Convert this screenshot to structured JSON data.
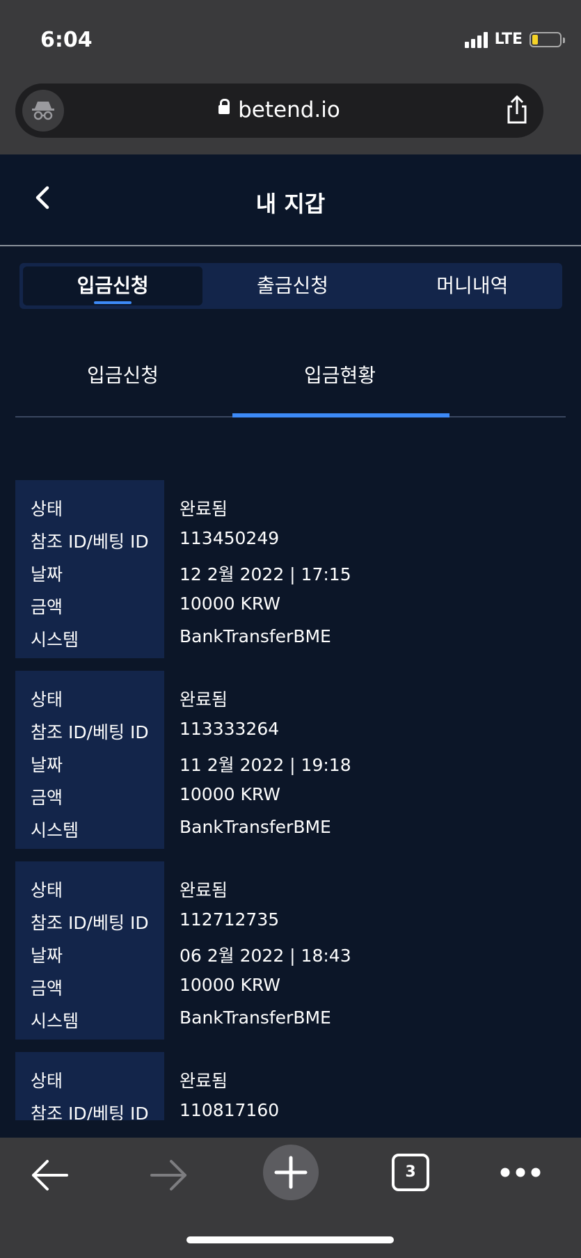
{
  "status_bar": {
    "time": "6:04",
    "network": "LTE",
    "battery_level": 0.2
  },
  "browser": {
    "url": "betend.io"
  },
  "header": {
    "title": "내 지갑"
  },
  "main_tabs": [
    {
      "label": "입금신청",
      "active": true
    },
    {
      "label": "출금신청",
      "active": false
    },
    {
      "label": "머니내역",
      "active": false
    }
  ],
  "sub_tabs": [
    {
      "label": "입금신청",
      "active": false
    },
    {
      "label": "입금현황",
      "active": true
    }
  ],
  "field_labels": {
    "status": "상태",
    "ref_id": "참조 ID/베팅 ID",
    "date": "날짜",
    "amount": "금액",
    "system": "시스템"
  },
  "records": [
    {
      "status": "완료됨",
      "ref_id": "113450249",
      "date": "12 2월 2022 | 17:15",
      "amount": "10000 KRW",
      "system": "BankTransferBME"
    },
    {
      "status": "완료됨",
      "ref_id": "113333264",
      "date": "11 2월 2022 | 19:18",
      "amount": "10000 KRW",
      "system": "BankTransferBME"
    },
    {
      "status": "완료됨",
      "ref_id": "112712735",
      "date": "06 2월 2022 | 18:43",
      "amount": "10000 KRW",
      "system": "BankTransferBME"
    },
    {
      "status": "완료됨",
      "ref_id": "110817160",
      "date": "",
      "amount": "",
      "system": ""
    }
  ],
  "toolbar": {
    "tab_count": "3"
  },
  "icons": [
    "incognito-icon",
    "lock-icon",
    "share-icon",
    "back-chevron-icon",
    "arrow-left-icon",
    "arrow-right-icon",
    "plus-icon",
    "tabs-icon",
    "more-icon"
  ]
}
